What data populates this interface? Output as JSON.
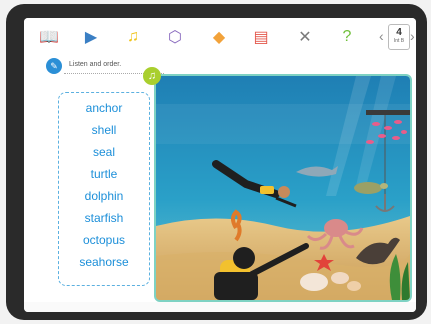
{
  "toolbar": {
    "icons": [
      {
        "name": "book-icon",
        "glyph": "📖",
        "color": "#3a7fc4"
      },
      {
        "name": "video-icon",
        "glyph": "▶",
        "color": "#3a7fc4"
      },
      {
        "name": "music-icon",
        "glyph": "♫",
        "color": "#f0c419"
      },
      {
        "name": "cube-icon",
        "glyph": "⬡",
        "color": "#8a6bbf"
      },
      {
        "name": "eraser-icon",
        "glyph": "◆",
        "color": "#f2a23a"
      },
      {
        "name": "document-icon",
        "glyph": "▤",
        "color": "#e3574b"
      },
      {
        "name": "tools-icon",
        "glyph": "✕",
        "color": "#7a7a7a"
      },
      {
        "name": "help-icon",
        "glyph": "?",
        "color": "#6fbf3a"
      }
    ],
    "page": {
      "number": "4",
      "sub": "Int B",
      "prev": "‹",
      "next": "›"
    }
  },
  "instruction": {
    "text": "Listen and order."
  },
  "words": [
    "anchor",
    "shell",
    "seal",
    "turtle",
    "dolphin",
    "starfish",
    "octopus",
    "seahorse"
  ],
  "colors": {
    "accent": "#1c8fd9",
    "audio": "#a9cf2e",
    "frame": "#7ed2c3"
  }
}
